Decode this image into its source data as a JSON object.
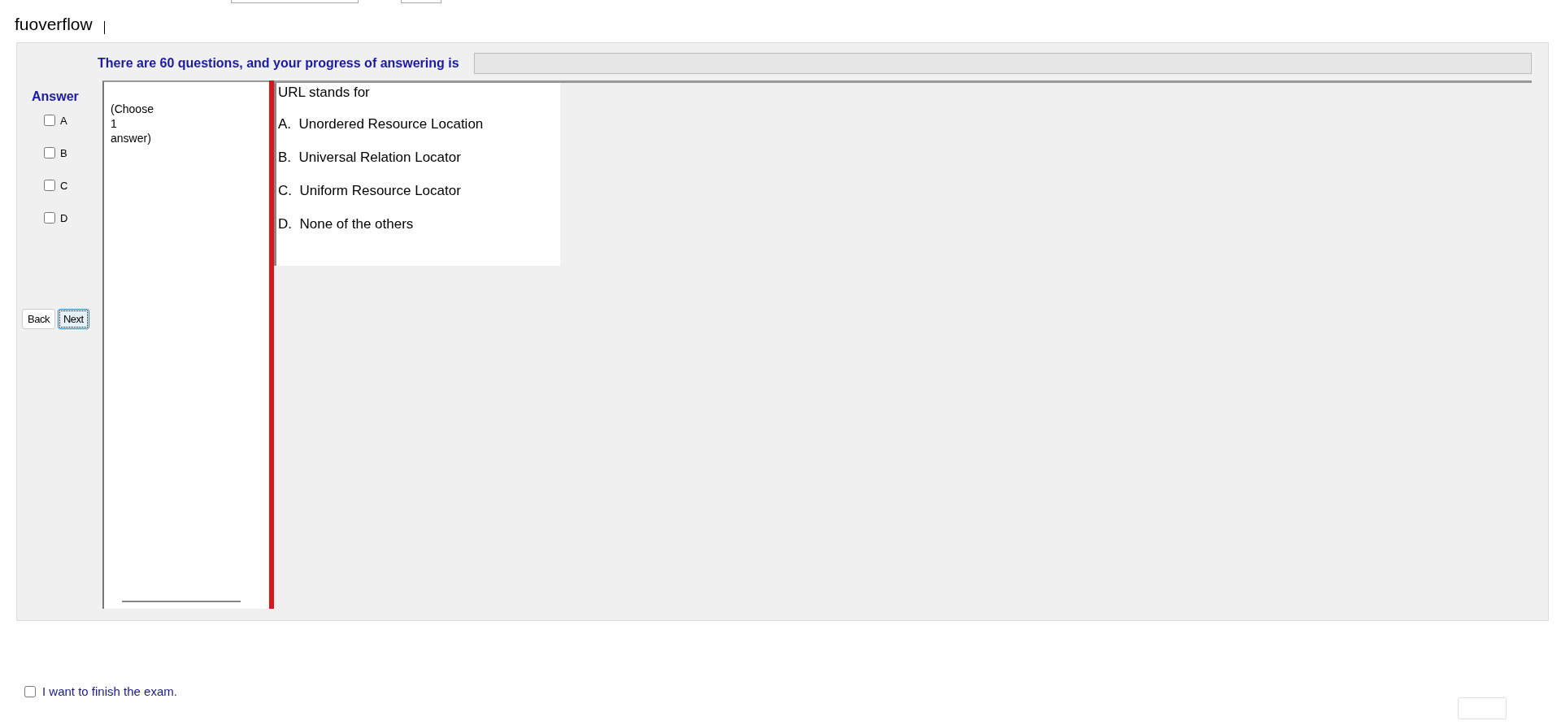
{
  "header": {
    "label": "fuoverflow"
  },
  "progress": {
    "text": "There are 60 questions, and your progress of answering is",
    "level": 0
  },
  "answer": {
    "title": "Answer",
    "options": [
      {
        "label": "A",
        "checked": false
      },
      {
        "label": "B",
        "checked": false
      },
      {
        "label": "C",
        "checked": false
      },
      {
        "label": "D",
        "checked": false
      }
    ]
  },
  "nav_buttons": [
    "Back",
    "Next"
  ],
  "instruction": [
    "(Choose",
    "1",
    "answer)"
  ],
  "question": {
    "text": "URL stands for",
    "choices": [
      "A.  Unordered Resource Location",
      "B.  Universal Relation Locator",
      "C.  Uniform Resource Locator",
      "D.  None of the others"
    ]
  },
  "finish": {
    "label": "I want to finish the exam.",
    "checked": false
  }
}
